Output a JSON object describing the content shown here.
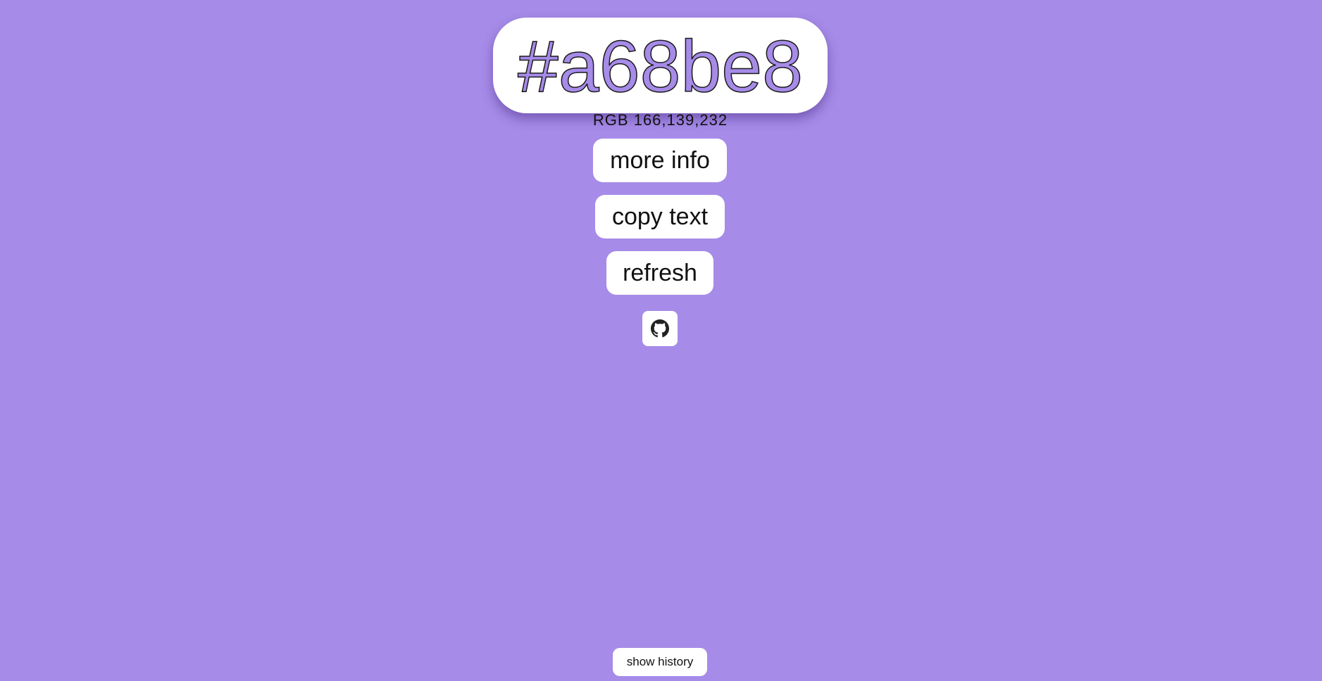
{
  "colors": {
    "background": "#a68be8",
    "card": "#ffffff",
    "text": "#111111"
  },
  "color_display": {
    "hex": "#a68be8",
    "rgb": "RGB 166,139,232"
  },
  "buttons": {
    "more_info": "more info",
    "copy_text": "copy text",
    "refresh": "refresh",
    "show_history": "show history"
  },
  "icons": {
    "github": "github-icon"
  }
}
